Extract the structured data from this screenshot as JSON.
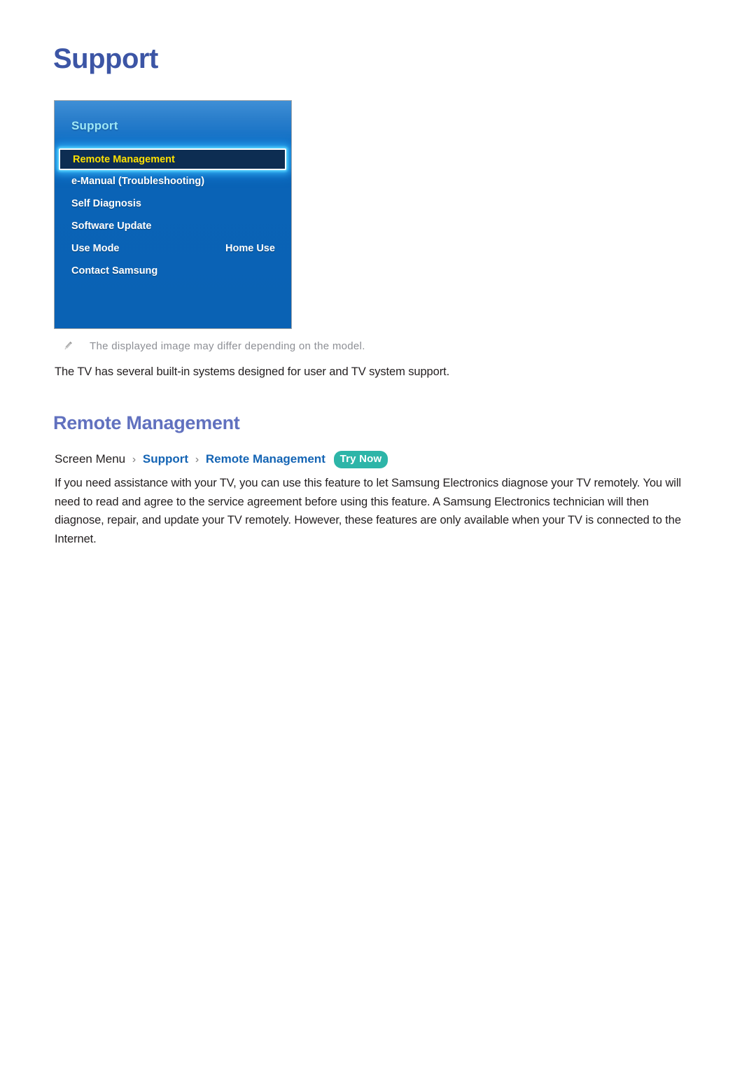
{
  "page": {
    "title": "Support"
  },
  "tv_panel": {
    "header": "Support",
    "menu_items": [
      {
        "label": "Remote Management",
        "value": "",
        "selected": true
      },
      {
        "label": "e-Manual (Troubleshooting)",
        "value": "",
        "selected": false
      },
      {
        "label": "Self Diagnosis",
        "value": "",
        "selected": false
      },
      {
        "label": "Software Update",
        "value": "",
        "selected": false
      },
      {
        "label": "Use Mode",
        "value": "Home Use",
        "selected": false
      },
      {
        "label": "Contact Samsung",
        "value": "",
        "selected": false
      }
    ],
    "colors": {
      "panel_top": "#3f8fd6",
      "panel_bottom": "#0a62b4",
      "header_text": "#9ee8f7",
      "selected_fill": "#0d2d52",
      "selected_text": "#ffe000",
      "selected_glow": "#5ad7ff"
    }
  },
  "note": {
    "icon": "pencil-icon",
    "text": "The displayed image may differ depending on the model."
  },
  "intro": {
    "text": "The TV has several built-in systems designed for user and TV system support."
  },
  "section": {
    "heading": "Remote Management",
    "breadcrumb": {
      "root": "Screen Menu",
      "separator": "›",
      "link1": "Support",
      "link2": "Remote Management",
      "badge": "Try Now"
    },
    "body": "If you need assistance with your TV, you can use this feature to let Samsung Electronics diagnose your TV remotely. You will need to read and agree to the service agreement before using this feature. A Samsung Electronics technician will then diagnose, repair, and update your TV remotely. However, these features are only available when your TV is connected to the Internet."
  },
  "colors": {
    "page_title": "#3c55a5",
    "section_heading": "#6171bf",
    "link_blue": "#1464b4",
    "badge_teal": "#2db5a8",
    "note_gray": "#8d8f95",
    "body_text": "#231f20"
  }
}
